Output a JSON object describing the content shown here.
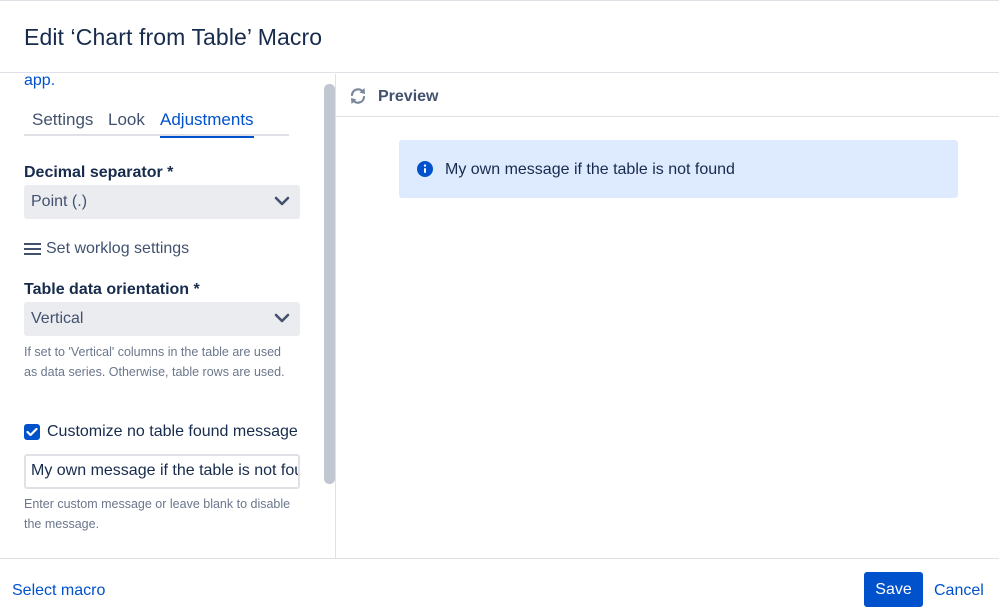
{
  "dialog": {
    "title": "Edit ‘Chart from Table’ Macro"
  },
  "left_panel": {
    "overflow_text": "app.",
    "tabs": [
      {
        "label": "Settings",
        "active": false
      },
      {
        "label": "Look",
        "active": false
      },
      {
        "label": "Adjustments",
        "active": true
      }
    ],
    "decimal_separator": {
      "label": "Decimal separator *",
      "value": "Point (.)"
    },
    "worklog_link": "Set worklog settings",
    "orientation": {
      "label": "Table data orientation *",
      "value": "Vertical",
      "help": "If set to 'Vertical' columns in the table are used as data series. Otherwise, table rows are used."
    },
    "no_table_message": {
      "checkbox_label": "Customize no table found message",
      "checked": true,
      "input_value": "My own message if the table is not found",
      "help": "Enter custom message or leave blank to disable the message."
    }
  },
  "preview": {
    "title": "Preview",
    "info_message": "My own message if the table is not found"
  },
  "footer": {
    "select_macro": "Select macro",
    "save": "Save",
    "cancel": "Cancel"
  },
  "colors": {
    "primary": "#0052cc",
    "info_bg": "#deebff",
    "select_bg": "#ebecf0",
    "text": "#172b4d",
    "subtle_text": "#6b778c"
  },
  "icons": [
    "refresh-icon",
    "info-icon",
    "menu-icon",
    "chevron-down-icon",
    "checkmark-icon"
  ]
}
